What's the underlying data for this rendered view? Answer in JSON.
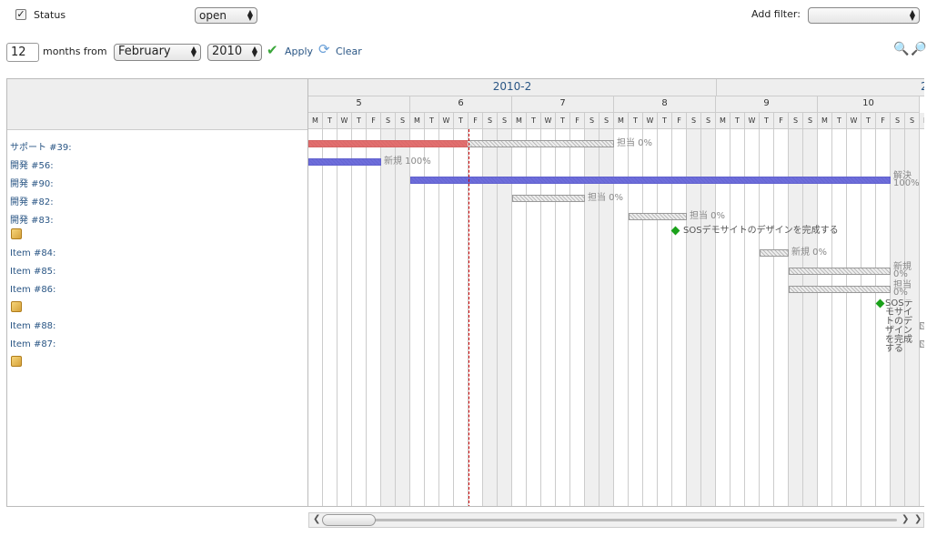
{
  "filter": {
    "status_label": "Status",
    "status_value": "open",
    "add_filter_label": "Add filter:",
    "add_filter_value": ""
  },
  "range": {
    "months_value": "12",
    "months_from_label": "months from",
    "month_value": "February",
    "year_value": "2010",
    "apply_label": "Apply",
    "clear_label": "Clear"
  },
  "gantt": {
    "month_header": "2010-2",
    "next_month_partial": "2",
    "weeks": [
      "5",
      "6",
      "7",
      "8",
      "9",
      "10"
    ],
    "day_letters": [
      "M",
      "T",
      "W",
      "T",
      "F",
      "S",
      "S"
    ],
    "rows": [
      {
        "subject": "サポート #39:",
        "type": "issue"
      },
      {
        "subject": "開発 #56:",
        "type": "issue"
      },
      {
        "subject": "開発 #90:",
        "type": "issue"
      },
      {
        "subject": "開発 #82:",
        "type": "issue"
      },
      {
        "subject": "開発 #83:",
        "type": "issue"
      },
      {
        "subject": "",
        "type": "version"
      },
      {
        "subject": "Item #84:",
        "type": "issue"
      },
      {
        "subject": "Item #85:",
        "type": "issue"
      },
      {
        "subject": "Item #86:",
        "type": "issue"
      },
      {
        "subject": "",
        "type": "version"
      },
      {
        "subject": "Item #88:",
        "type": "issue"
      },
      {
        "subject": "Item #87:",
        "type": "issue"
      },
      {
        "subject": "",
        "type": "version"
      }
    ],
    "bar_labels": {
      "r39": "担当 0%",
      "r56": "新規 100%",
      "r90a": "解決",
      "r90b": "100%",
      "r82": "担当 0%",
      "r83": "担当 0%",
      "milestone1": "SOSデモサイトのデザインを完成する",
      "r84": "新規 0%",
      "r85a": "新規",
      "r85b": "0%",
      "r86a": "担当",
      "r86b": "0%",
      "milestone2": "SOSデモサイトのデザインを完成する"
    },
    "colors": {
      "late": "#e05a5a",
      "done": "#5858d8",
      "today_line": "#d00000"
    }
  }
}
